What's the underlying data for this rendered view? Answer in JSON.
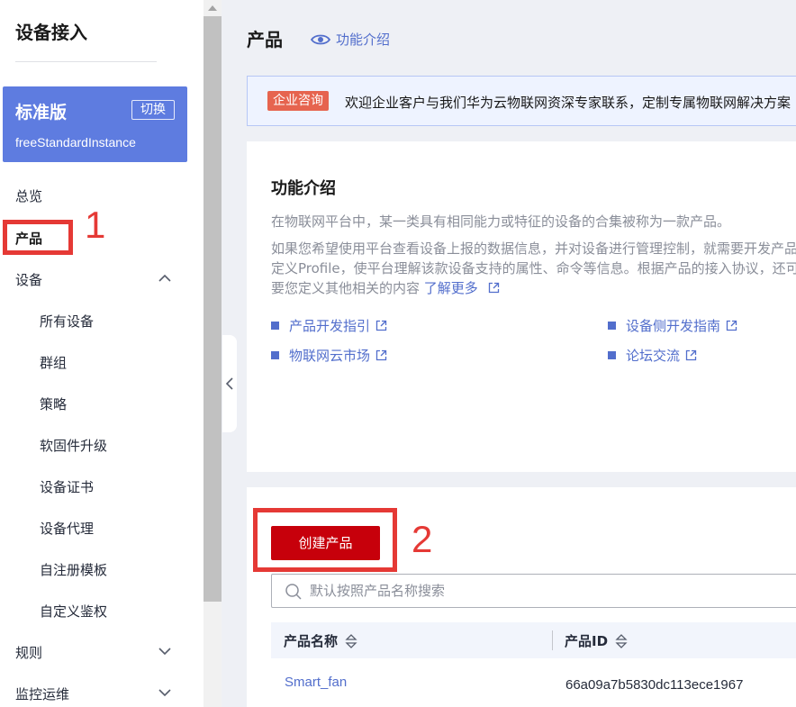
{
  "sidebar": {
    "title": "设备接入",
    "edition": {
      "name": "标准版",
      "switch_label": "切换",
      "instance": "freeStandardInstance"
    },
    "items": [
      {
        "label": "总览"
      },
      {
        "label": "产品"
      },
      {
        "label": "设备"
      },
      {
        "label": "规则"
      },
      {
        "label": "监控运维"
      }
    ],
    "device_sub": [
      "所有设备",
      "群组",
      "策略",
      "软固件升级",
      "设备证书",
      "设备代理",
      "自注册模板",
      "自定义鉴权"
    ]
  },
  "header": {
    "title": "产品",
    "intro_link": "功能介绍"
  },
  "notice": {
    "tag": "企业咨询",
    "text": "欢迎企业客户与我们华为云物联网资深专家联系，定制专属物联网解决方案"
  },
  "feature_intro": {
    "title": "功能介绍",
    "desc1": "在物联网平台中，某一类具有相同能力或特征的设备的合集被称为一款产品。",
    "desc2_line1": "如果您希望使用平台查看设备上报的数据信息，并对设备进行管理控制，就需要开发产品模型",
    "desc2_line2": "定义Profile，使平台理解该款设备支持的属性、命令等信息。根据产品的接入协议，还可能需",
    "desc2_line3": "要您定义其他相关的内容",
    "learn_more": "了解更多",
    "links": [
      "产品开发指引",
      "设备侧开发指南",
      "物联网云市场",
      "论坛交流"
    ]
  },
  "products": {
    "create_label": "创建产品",
    "search_placeholder": "默认按照产品名称搜索",
    "columns": [
      "产品名称",
      "产品ID"
    ],
    "rows": [
      {
        "name": "Smart_fan",
        "id": "66a09a7b5830dc113ece1967"
      }
    ]
  },
  "annotations": [
    "1",
    "2"
  ],
  "colors": {
    "accent": "#5e7ce0",
    "link": "#526ecc",
    "primary_button": "#c7000b",
    "annotation": "#e53935"
  }
}
